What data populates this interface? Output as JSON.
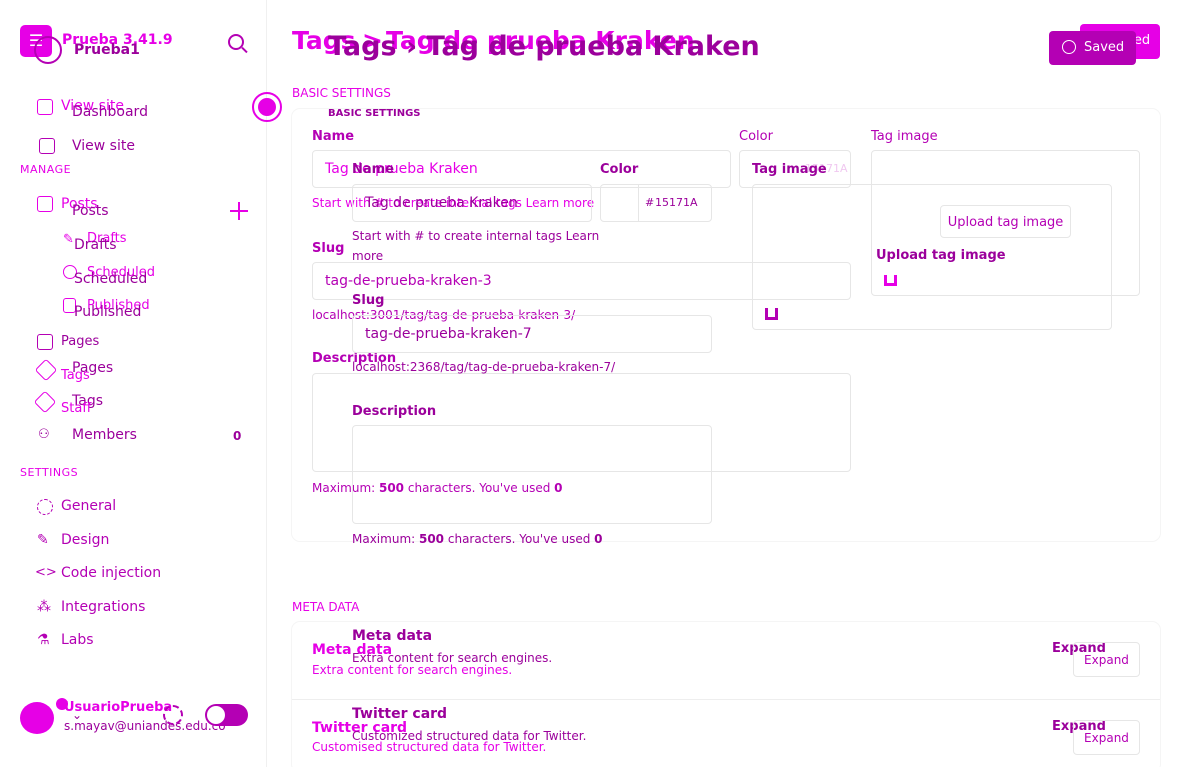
{
  "sidebar": {
    "site_version": "Prueba 3.41.9",
    "site_name": "Prueba1",
    "view_site_ghost": "View site",
    "dashboard": "Dashboard",
    "view_site": "View site",
    "manage_label": "MANAGE",
    "posts": "Posts",
    "posts_ghost": "Posts",
    "drafts": "Drafts",
    "drafts_ghost": "Drafts",
    "scheduled": "Scheduled",
    "scheduled_ghost": "Scheduled",
    "published": "Published",
    "published_ghost": "Published",
    "pages": "Pages",
    "pages_ghost": "Pages",
    "tags": "Tags",
    "tags_ghost": "Tags",
    "staff": "Staff",
    "members": "Members",
    "members_count": "0",
    "settings_label": "SETTINGS",
    "general": "General",
    "design": "Design",
    "code_injection": "Code injection",
    "integrations": "Integrations",
    "labs": "Labs",
    "user_name": "UsuarioPrueba",
    "user_email": "s.mayav@uniandes.edu.co"
  },
  "header": {
    "crumb_a_tags": "Tags",
    "crumb_a_sep": ">",
    "crumb_a_tag": "Tag de prueba Kraken",
    "crumb_b": "Tags › Tag de prueba Kraken",
    "save_a": "Saved",
    "save_b": "Saved"
  },
  "basic": {
    "section_a": "BASIC SETTINGS",
    "section_b": "BASIC SETTINGS",
    "name_label_a": "Name",
    "name_value_a": "Tag de prueba Kraken",
    "name_help_a": "Start with # to create internal tags Learn more",
    "slug_label_a": "Slug",
    "slug_value_a": "tag-de-prueba-kraken-3",
    "slug_url_a": "localhost:3001/tag/tag-de-prueba-kraken-3/",
    "desc_label_a": "Description",
    "desc_help_a_1": "Maximum: ",
    "desc_help_a_2": "500",
    "desc_help_a_3": " characters. You've used ",
    "desc_help_a_4": "0",
    "color_label_a": "Color",
    "color_placeholder_a": "15171A",
    "image_label_a": "Tag image",
    "upload_a": "Upload tag image",
    "name_label_b": "Name",
    "name_value_b": "Tag de prueba Kraken",
    "name_help_b_1": "Start with # to create internal tags Learn",
    "name_help_b_2": "more",
    "color_label_b": "Color",
    "color_hash_b": "#",
    "color_value_b": "15171A",
    "image_label_b": "Tag image",
    "upload_b": "Upload tag image",
    "slug_label_b": "Slug",
    "slug_value_b": "tag-de-prueba-kraken-7",
    "slug_url_b": "localhost:2368/tag/tag-de-prueba-kraken-7/",
    "desc_label_b": "Description",
    "desc_help_b_1": "Maximum: ",
    "desc_help_b_2": "500",
    "desc_help_b_3": " characters. You've used ",
    "desc_help_b_4": "0"
  },
  "meta": {
    "section": "META DATA",
    "meta_title_a": "Meta data",
    "meta_sub_a": "Extra content for search engines.",
    "meta_title_b": "Meta data",
    "meta_sub_b": "Extra content for search engines.",
    "expand_a": "Expand",
    "expand_b": "Expand",
    "twitter_title_a": "Twitter card",
    "twitter_sub_a": "Customised structured data for Twitter.",
    "twitter_title_b": "Twitter card",
    "twitter_sub_b": "Customized structured data for Twitter.",
    "expand_c": "Expand",
    "expand_d": "Expand"
  },
  "colors": {
    "magenta": "#e600e6",
    "purple": "#b400b4",
    "dark_purple": "#9b009b"
  }
}
